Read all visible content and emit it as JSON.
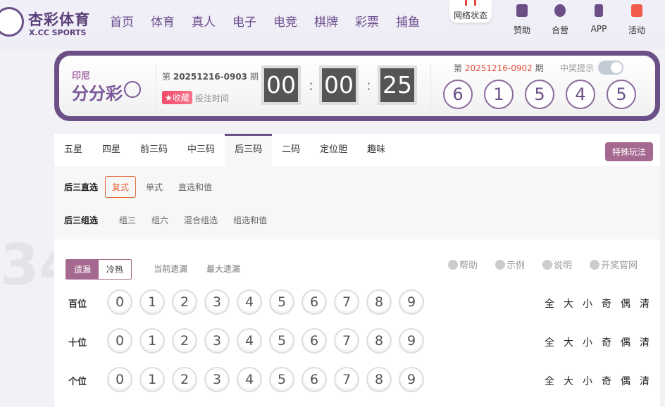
{
  "header": {
    "logo_cn": "杏彩体育",
    "logo_en": "X.CC SPORTS",
    "nav": [
      "首页",
      "体育",
      "真人",
      "电子",
      "电竞",
      "棋牌",
      "彩票",
      "捕鱼"
    ],
    "network_status": "网络状态",
    "right": [
      {
        "label": "赞助",
        "icon": "bookmark-icon"
      },
      {
        "label": "合营",
        "icon": "handshake-icon"
      },
      {
        "label": "APP",
        "icon": "phone-icon"
      },
      {
        "label": "活动",
        "icon": "gift-icon"
      }
    ]
  },
  "lottery": {
    "region": "印尼",
    "name": "分分彩",
    "issue_prefix": "第",
    "issue": "20251216-0903",
    "issue_suffix": "期",
    "favorite": "★收藏",
    "bet_time": "投注时间",
    "countdown": [
      "00",
      "00",
      "25"
    ],
    "last_prefix": "第",
    "last_issue": "20251216-0902",
    "last_suffix": "期",
    "win_tip": "中奖提示",
    "win_tip_on": true,
    "results": [
      "6",
      "1",
      "5",
      "4",
      "5"
    ]
  },
  "tabs": {
    "items": [
      "五星",
      "四星",
      "前三码",
      "中三码",
      "后三码",
      "二码",
      "定位胆",
      "趣味"
    ],
    "active": "后三码",
    "special": "特殊玩法"
  },
  "subplay": {
    "direct_title": "后三直选",
    "direct": [
      "复式",
      "单式",
      "直选和值"
    ],
    "selected": "复式",
    "group_title": "后三组选",
    "group": [
      "组三",
      "组六",
      "混合组选",
      "组选和值"
    ]
  },
  "stats": {
    "toggle": [
      "遗漏",
      "冷热"
    ],
    "active": "遗漏",
    "current_miss": "当前遗漏",
    "max_miss": "最大遗漏",
    "help": [
      "帮助",
      "示例",
      "说明",
      "开奖官网"
    ]
  },
  "positions": [
    "百位",
    "十位",
    "个位"
  ],
  "digits": [
    "0",
    "1",
    "2",
    "3",
    "4",
    "5",
    "6",
    "7",
    "8",
    "9"
  ],
  "quick": [
    "全",
    "大",
    "小",
    "奇",
    "偶",
    "清"
  ],
  "colors": {
    "brand": "#6a5087",
    "accent": "#a5688e",
    "highlight": "#e26a3a"
  }
}
